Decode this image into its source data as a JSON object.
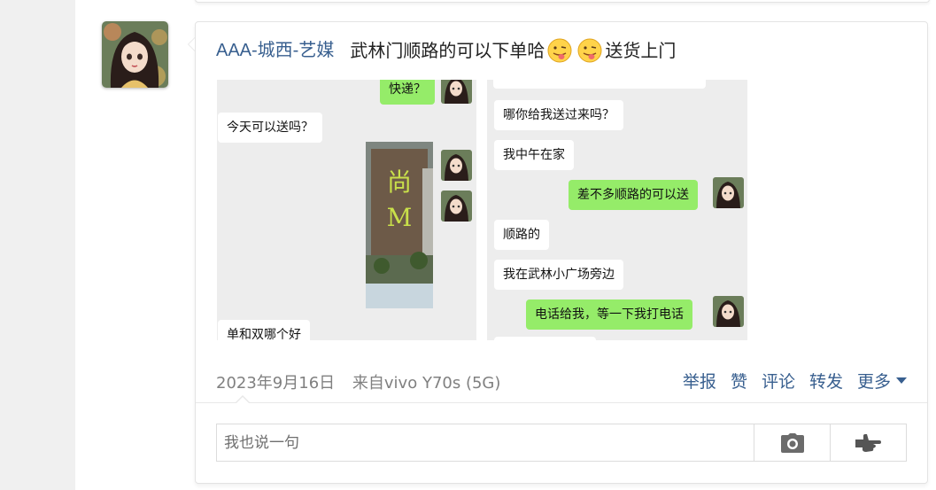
{
  "post": {
    "author": "AAA-城西-艺媒",
    "text_before": "武林门顺路的可以下单哈",
    "text_after": "送货上门",
    "emojis": [
      "tongue-out-emoji",
      "tongue-out-emoji"
    ]
  },
  "screenshot_left": {
    "messages": [
      {
        "text": "快递？",
        "side": "right",
        "color": "green"
      },
      {
        "text": "今天可以送吗？",
        "side": "left",
        "color": "white"
      },
      {
        "text": "单和双哪个好",
        "side": "left",
        "color": "white"
      }
    ],
    "photo_sign": {
      "line1": "尚",
      "line2": "M"
    }
  },
  "screenshot_right": {
    "messages": [
      {
        "text": "哪你给我送过来吗？",
        "side": "left",
        "color": "white"
      },
      {
        "text": "我中午在家",
        "side": "left",
        "color": "white"
      },
      {
        "text": "差不多顺路的可以送",
        "side": "right",
        "color": "green"
      },
      {
        "text": "顺路的",
        "side": "left",
        "color": "white"
      },
      {
        "text": "我在武林小广场旁边",
        "side": "left",
        "color": "white"
      },
      {
        "text": "电话给我，等一下我打电话",
        "side": "right",
        "color": "green"
      }
    ]
  },
  "meta": {
    "date": "2023年9月16日",
    "source": "来自vivo Y70s (5G)"
  },
  "actions": {
    "report": "举报",
    "like": "赞",
    "comment": "评论",
    "repost": "转发",
    "more": "更多"
  },
  "comment": {
    "placeholder": "我也说一句",
    "camera_icon": "camera-icon",
    "send_icon": "pointing-hand-icon"
  },
  "colors": {
    "author_link": "#385f8f",
    "action_link": "#385f8f",
    "wechat_green": "#95ec69",
    "chat_background": "#ededed"
  }
}
